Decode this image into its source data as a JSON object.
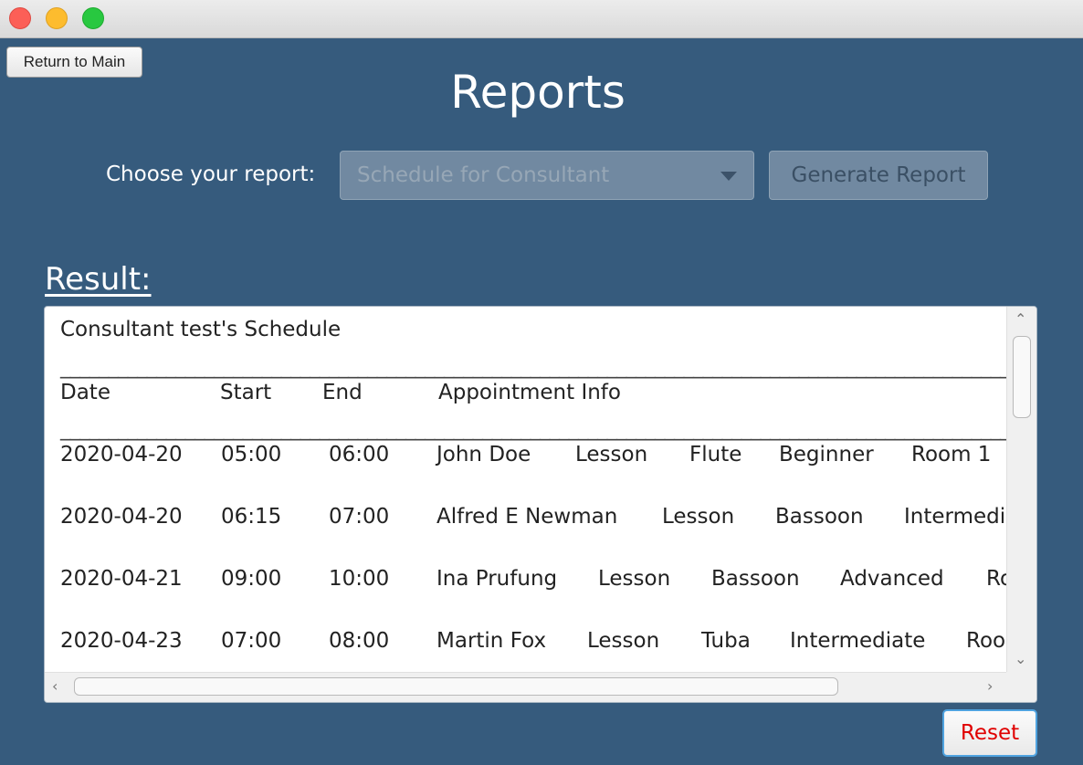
{
  "window": {
    "controls": [
      "close",
      "minimize",
      "maximize"
    ]
  },
  "nav": {
    "return_label": "Return to Main"
  },
  "header": {
    "title": "Reports"
  },
  "report_picker": {
    "label": "Choose your report:",
    "selected": "Schedule for Consultant",
    "generate_label": "Generate Report"
  },
  "result": {
    "label": "Result:",
    "heading": "Consultant test's Schedule",
    "separator": "________________________________________________________________________________________________________________",
    "columns": {
      "date": "Date",
      "start": "Start",
      "end": "End",
      "info": "Appointment Info"
    },
    "rows": [
      {
        "date": "2020-04-20",
        "start": "05:00",
        "end": "06:00",
        "info": [
          "John Doe",
          "Lesson",
          "Flute",
          "Beginner",
          "Room 1"
        ]
      },
      {
        "date": "2020-04-20",
        "start": "06:15",
        "end": "07:00",
        "info": [
          "Alfred E Newman",
          "Lesson",
          "Bassoon",
          "Intermedi"
        ]
      },
      {
        "date": "2020-04-21",
        "start": "09:00",
        "end": "10:00",
        "info": [
          "Ina Prufung",
          "Lesson",
          "Bassoon",
          "Advanced",
          "Ro"
        ]
      },
      {
        "date": "2020-04-23",
        "start": "07:00",
        "end": "08:00",
        "info": [
          "Martin Fox",
          "Lesson",
          "Tuba",
          "Intermediate",
          "Roo"
        ]
      }
    ]
  },
  "footer": {
    "reset_label": "Reset",
    "reset_color": "#e00000"
  },
  "colors": {
    "background": "#365b7d",
    "disabled_control": "#7189a1"
  }
}
